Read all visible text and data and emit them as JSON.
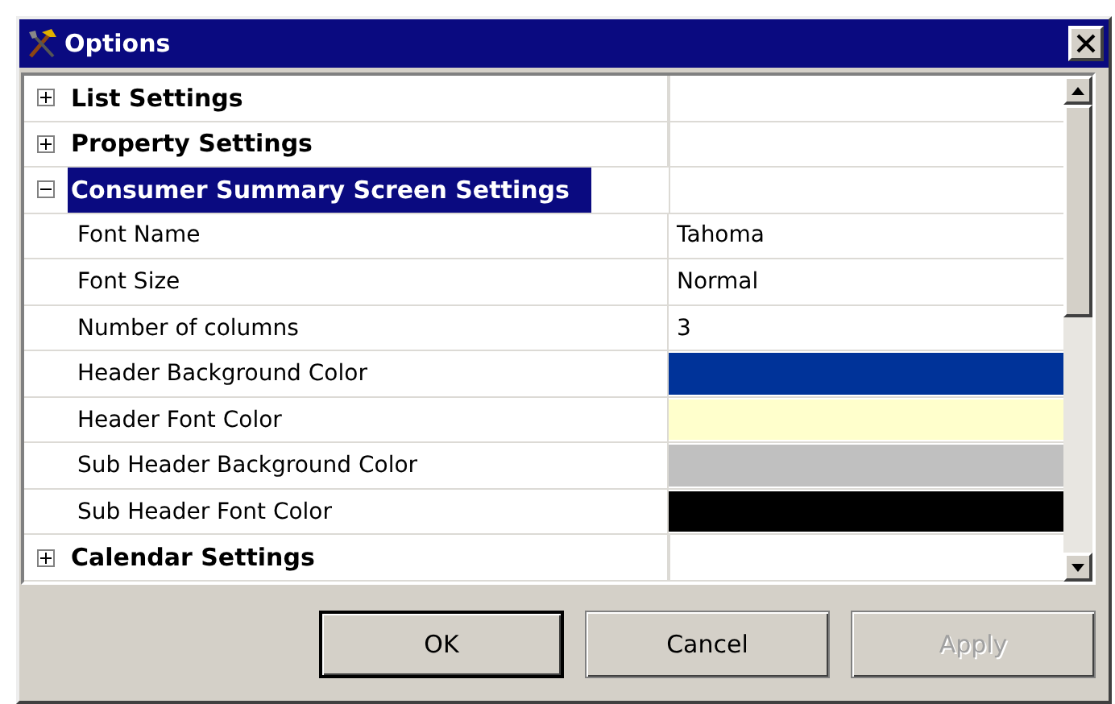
{
  "window": {
    "title": "Options"
  },
  "categories": [
    {
      "label": "List Settings",
      "expanded": false,
      "selected": false
    },
    {
      "label": "Property Settings",
      "expanded": false,
      "selected": false
    },
    {
      "label": "Consumer Summary Screen Settings",
      "expanded": true,
      "selected": true,
      "properties": [
        {
          "name": "Font Name",
          "kind": "text",
          "value": "Tahoma"
        },
        {
          "name": "Font Size",
          "kind": "text",
          "value": "Normal"
        },
        {
          "name": "Number of columns",
          "kind": "text",
          "value": "3"
        },
        {
          "name": "Header Background Color",
          "kind": "color",
          "color": "#003399"
        },
        {
          "name": "Header Font Color",
          "kind": "color",
          "color": "#ffffcc"
        },
        {
          "name": "Sub Header Background Color",
          "kind": "color",
          "color": "#c0c0c0"
        },
        {
          "name": "Sub Header Font Color",
          "kind": "color",
          "color": "#000000"
        }
      ]
    },
    {
      "label": "Calendar Settings",
      "expanded": false,
      "selected": false
    }
  ],
  "buttons": [
    {
      "label": "OK",
      "disabled": false,
      "default": true
    },
    {
      "label": "Cancel",
      "disabled": false,
      "default": false
    },
    {
      "label": "Apply",
      "disabled": true,
      "default": false
    }
  ]
}
